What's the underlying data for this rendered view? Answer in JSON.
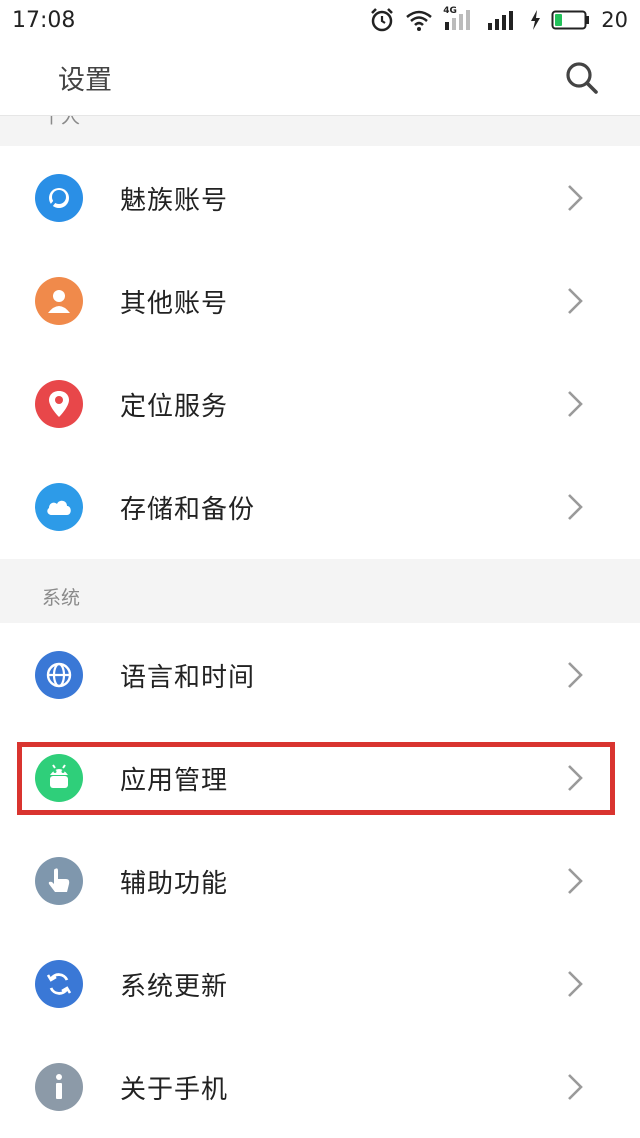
{
  "status": {
    "time": "17:08",
    "network": "4G",
    "battery": "20"
  },
  "header": {
    "title": "设置"
  },
  "sections": [
    {
      "title": "个人"
    },
    {
      "title": "系统"
    }
  ],
  "personal_items": [
    {
      "label": "魅族账号",
      "icon": "meizu-account-icon",
      "color": "#2a8fe6"
    },
    {
      "label": "其他账号",
      "icon": "person-icon",
      "color": "#f08a4b"
    },
    {
      "label": "定位服务",
      "icon": "location-pin-icon",
      "color": "#e8474a"
    },
    {
      "label": "存储和备份",
      "icon": "cloud-icon",
      "color": "#2d9be8"
    }
  ],
  "system_items": [
    {
      "label": "语言和时间",
      "icon": "globe-icon",
      "color": "#3a78d6"
    },
    {
      "label": "应用管理",
      "icon": "android-icon",
      "color": "#2fcf7a"
    },
    {
      "label": "辅助功能",
      "icon": "hand-pointer-icon",
      "color": "#7f97ad"
    },
    {
      "label": "系统更新",
      "icon": "refresh-icon",
      "color": "#3a78d6"
    },
    {
      "label": "关于手机",
      "icon": "info-icon",
      "color": "#8c9aa8"
    }
  ],
  "colors": {
    "highlight": "#d9342f",
    "section_bg": "#f4f4f4"
  }
}
